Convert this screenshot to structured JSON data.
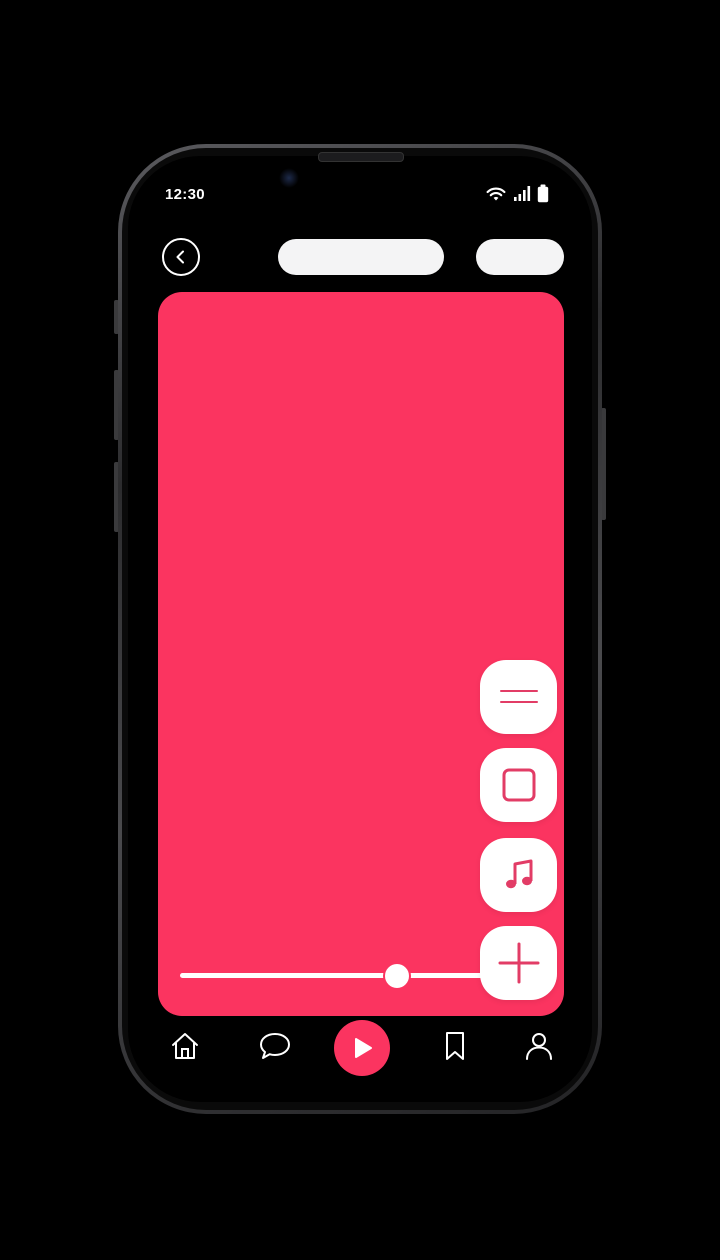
{
  "status_bar": {
    "time": "12:30",
    "icons": [
      "wifi-icon",
      "signal-icon",
      "battery-icon"
    ]
  },
  "header": {
    "back_icon": "chevron-left-icon",
    "pill_primary": "",
    "pill_secondary": ""
  },
  "canvas": {
    "color": "#fb3460",
    "slider_value": 0.7
  },
  "tools": [
    {
      "name": "menu",
      "icon": "two-lines-icon"
    },
    {
      "name": "shape",
      "icon": "square-icon"
    },
    {
      "name": "music",
      "icon": "music-note-icon"
    },
    {
      "name": "add",
      "icon": "plus-icon"
    }
  ],
  "bottom_nav": {
    "items": [
      "home-icon",
      "chat-icon",
      "play-icon",
      "bookmark-icon",
      "profile-icon"
    ],
    "active": "play-icon"
  },
  "colors": {
    "accent": "#fb3460",
    "background": "#000000",
    "surface": "#ffffff"
  }
}
